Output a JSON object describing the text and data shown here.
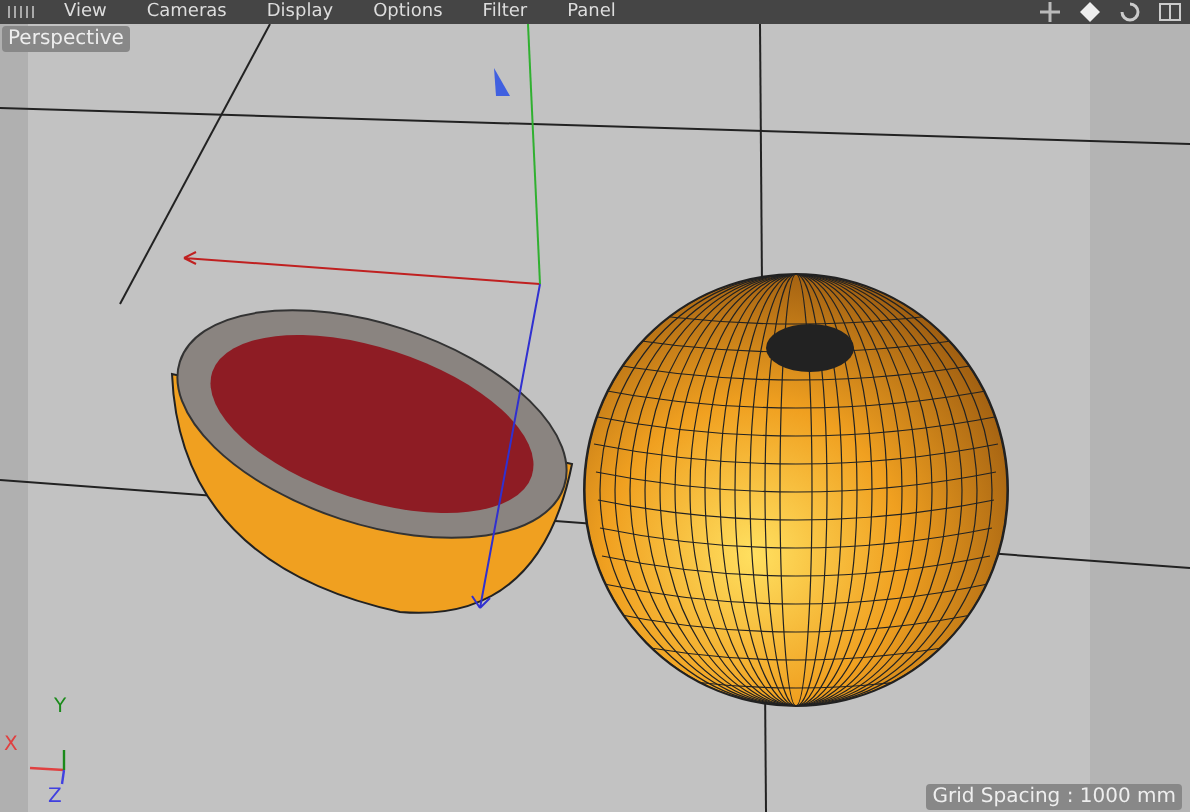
{
  "menu": [
    {
      "label": "View"
    },
    {
      "label": "Cameras"
    },
    {
      "label": "Display"
    },
    {
      "label": "Options"
    },
    {
      "label": "Filter"
    },
    {
      "label": "Panel"
    }
  ],
  "viewport": {
    "camera": "Perspective",
    "axes": [
      {
        "label": "X",
        "color": "#e04040"
      },
      {
        "label": "Y",
        "color": "#1a8a1a"
      },
      {
        "label": "Z",
        "color": "#4040e0"
      }
    ],
    "grid_spacing": "Grid Spacing : 1000 mm"
  }
}
